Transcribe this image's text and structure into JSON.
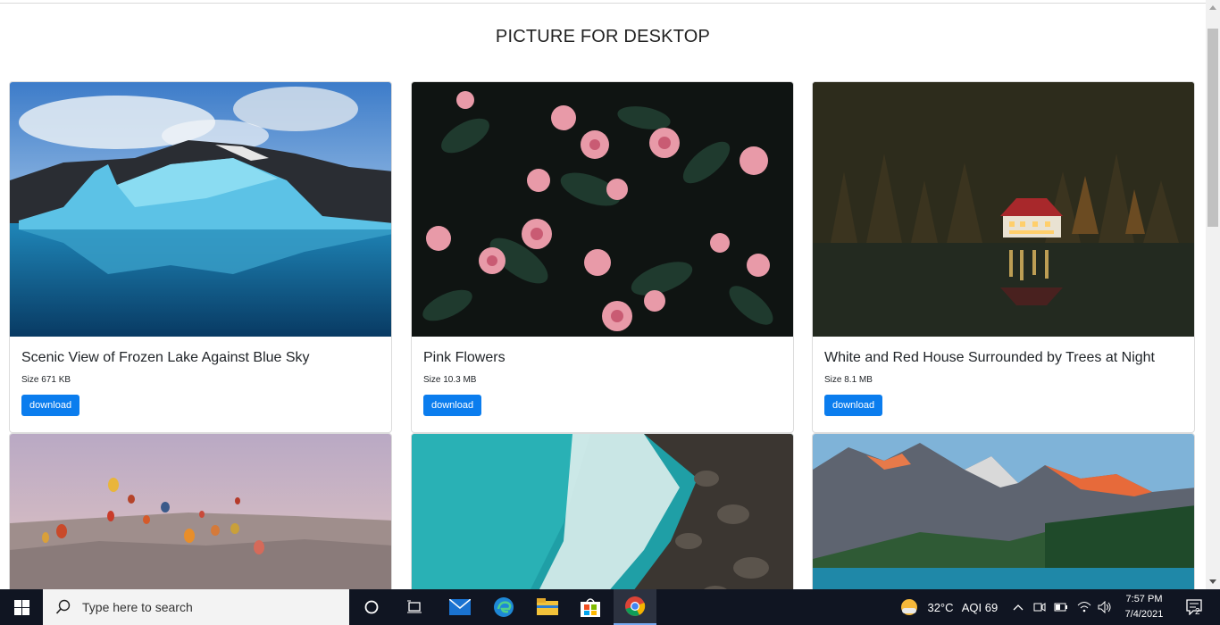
{
  "page": {
    "title": "PICTURE FOR DESKTOP"
  },
  "cards": [
    {
      "title": "Scenic View of Frozen Lake Against Blue Sky",
      "size": "Size 671 KB",
      "button": "download"
    },
    {
      "title": "Pink Flowers",
      "size": "Size 10.3 MB",
      "button": "download"
    },
    {
      "title": "White and Red House Surrounded by Trees at Night",
      "size": "Size 8.1 MB",
      "button": "download"
    }
  ],
  "taskbar": {
    "search_placeholder": "Type here to search",
    "weather": {
      "temp": "32°C",
      "aqi": "AQI 69"
    },
    "time": "7:57 PM",
    "date": "7/4/2021",
    "notifications": "2"
  },
  "colors": {
    "accent": "#0b7dee",
    "taskbar": "#101522"
  }
}
